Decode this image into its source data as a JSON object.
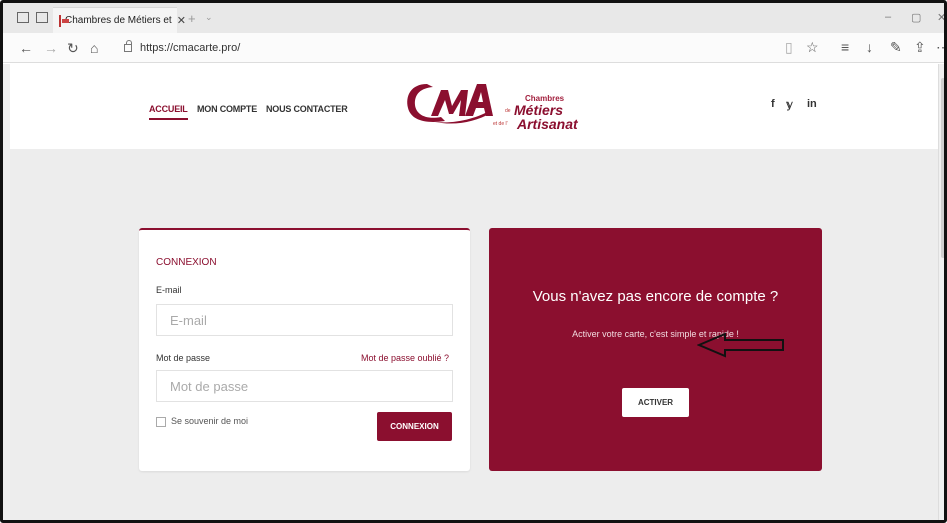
{
  "browser": {
    "tab_title": "Chambres de Métiers et",
    "tab_close": "✕",
    "new_tab": "+",
    "tab_menu": "⌄",
    "url": "https://cmacarte.pro/",
    "window": {
      "minimize": "–",
      "maximize": "▢",
      "close": "✕"
    }
  },
  "site": {
    "menu": [
      "ACCUEIL",
      "MON COMPTE",
      "NOUS CONTACTER"
    ],
    "logo": {
      "line1": "Chambres",
      "line2": "Métiers",
      "line3": "Artisanat",
      "small_de": "de",
      "small_et": "et de l'"
    },
    "social": [
      "f",
      "𝕪",
      "in"
    ]
  },
  "login": {
    "title": "CONNEXION",
    "email_label": "E-mail",
    "email_placeholder": "E-mail",
    "password_label": "Mot de passe",
    "password_placeholder": "Mot de passe",
    "forgot": "Mot de passe oublié ?",
    "remember": "Se souvenir de moi",
    "submit": "CONNEXION"
  },
  "activate": {
    "title": "Vous n'avez pas encore de compte ?",
    "subtitle": "Activer votre carte, c'est simple et rapide !",
    "button": "ACTIVER"
  },
  "colors": {
    "brand": "#8b0f2f",
    "page_bg": "#ededed"
  }
}
